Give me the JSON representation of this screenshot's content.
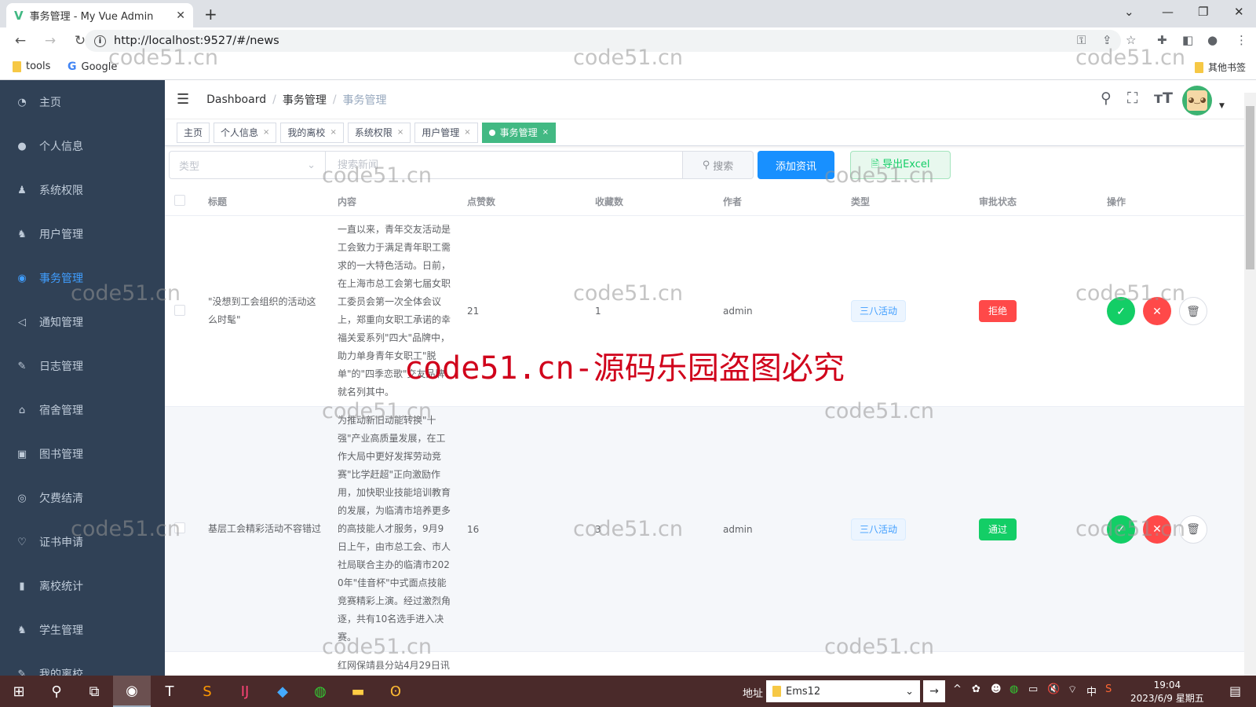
{
  "browser": {
    "tab_title": "事务管理 - My Vue Admin",
    "url": "http://localhost:9527/#/news",
    "bookmarks": [
      "tools",
      "Google"
    ],
    "other_bookmarks": "其他书签"
  },
  "sidebar": {
    "items": [
      {
        "label": "主页",
        "icon": "dashboard-icon",
        "glyph": "◔"
      },
      {
        "label": "个人信息",
        "icon": "user-icon",
        "glyph": "●"
      },
      {
        "label": "系统权限",
        "icon": "user-lock-icon",
        "glyph": "♟"
      },
      {
        "label": "用户管理",
        "icon": "users-icon",
        "glyph": "♞"
      },
      {
        "label": "事务管理",
        "icon": "news-icon",
        "glyph": "◉",
        "active": true
      },
      {
        "label": "通知管理",
        "icon": "speaker-icon",
        "glyph": "◁"
      },
      {
        "label": "日志管理",
        "icon": "feather-icon",
        "glyph": "✎"
      },
      {
        "label": "宿舍管理",
        "icon": "building-icon",
        "glyph": "⌂"
      },
      {
        "label": "图书管理",
        "icon": "book-icon",
        "glyph": "▣"
      },
      {
        "label": "欠费结清",
        "icon": "location-icon",
        "glyph": "◎"
      },
      {
        "label": "证书申请",
        "icon": "certificate-icon",
        "glyph": "♡"
      },
      {
        "label": "离校统计",
        "icon": "bar-chart-icon",
        "glyph": "▮"
      },
      {
        "label": "学生管理",
        "icon": "students-icon",
        "glyph": "♞"
      },
      {
        "label": "我的离校",
        "icon": "feather-icon",
        "glyph": "✎"
      }
    ]
  },
  "navbar": {
    "breadcrumb": [
      "Dashboard",
      "事务管理",
      "事务管理"
    ]
  },
  "tags": [
    {
      "label": "主页",
      "closable": false
    },
    {
      "label": "个人信息",
      "closable": true
    },
    {
      "label": "我的离校",
      "closable": true
    },
    {
      "label": "系统权限",
      "closable": true
    },
    {
      "label": "用户管理",
      "closable": true
    },
    {
      "label": "事务管理",
      "closable": true,
      "active": true
    }
  ],
  "filter": {
    "type_placeholder": "类型",
    "search_placeholder": "搜索新闻",
    "search_label": "搜索",
    "add_label": "添加资讯",
    "export_label": "导出Excel"
  },
  "table": {
    "headers": [
      "标题",
      "内容",
      "点赞数",
      "收藏数",
      "作者",
      "类型",
      "审批状态",
      "操作"
    ],
    "rows": [
      {
        "title": "\"没想到工会组织的活动这么时髦\"",
        "content": "一直以来，青年交友活动是工会致力于满足青年职工需求的一大特色活动。日前，在上海市总工会第七届女职工委员会第一次全体会议上，郑重向女职工承诺的幸福关爱系列\"四大\"品牌中，助力单身青年女职工\"脱单\"的\"四季恋歌\"交友品牌就名列其中。",
        "likes": "21",
        "favorites": "1",
        "author": "admin",
        "type": "三八活动",
        "status": "拒绝",
        "status_color": "#ff4949"
      },
      {
        "title": "基层工会精彩活动不容错过",
        "content": "为推动新旧动能转换\"十强\"产业高质量发展，在工作大局中更好发挥劳动竞赛\"比学赶超\"正向激励作用，加快职业技能培训教育的发展，为临清市培养更多的高技能人才服务，9月9日上午，由市总工会、市人社局联合主办的临清市2020年\"佳音杯\"中式面点技能竞赛精彩上演。经过激烈角逐，共有10名选手进入决赛。",
        "likes": "16",
        "favorites": "3",
        "author": "admin",
        "type": "三八活动",
        "status": "通过",
        "status_color": "#13ce66"
      },
      {
        "title": "",
        "content": "红网保靖县分站4月29日讯",
        "likes": "",
        "favorites": "",
        "author": "",
        "type": "",
        "status": ""
      }
    ]
  },
  "watermark": {
    "small": "code51.cn",
    "big": "code51.cn-源码乐园盗图必究"
  },
  "taskbar": {
    "address_label": "地址",
    "address_value": "Ems12",
    "time": "19:04",
    "date": "2023/6/9 星期五"
  }
}
